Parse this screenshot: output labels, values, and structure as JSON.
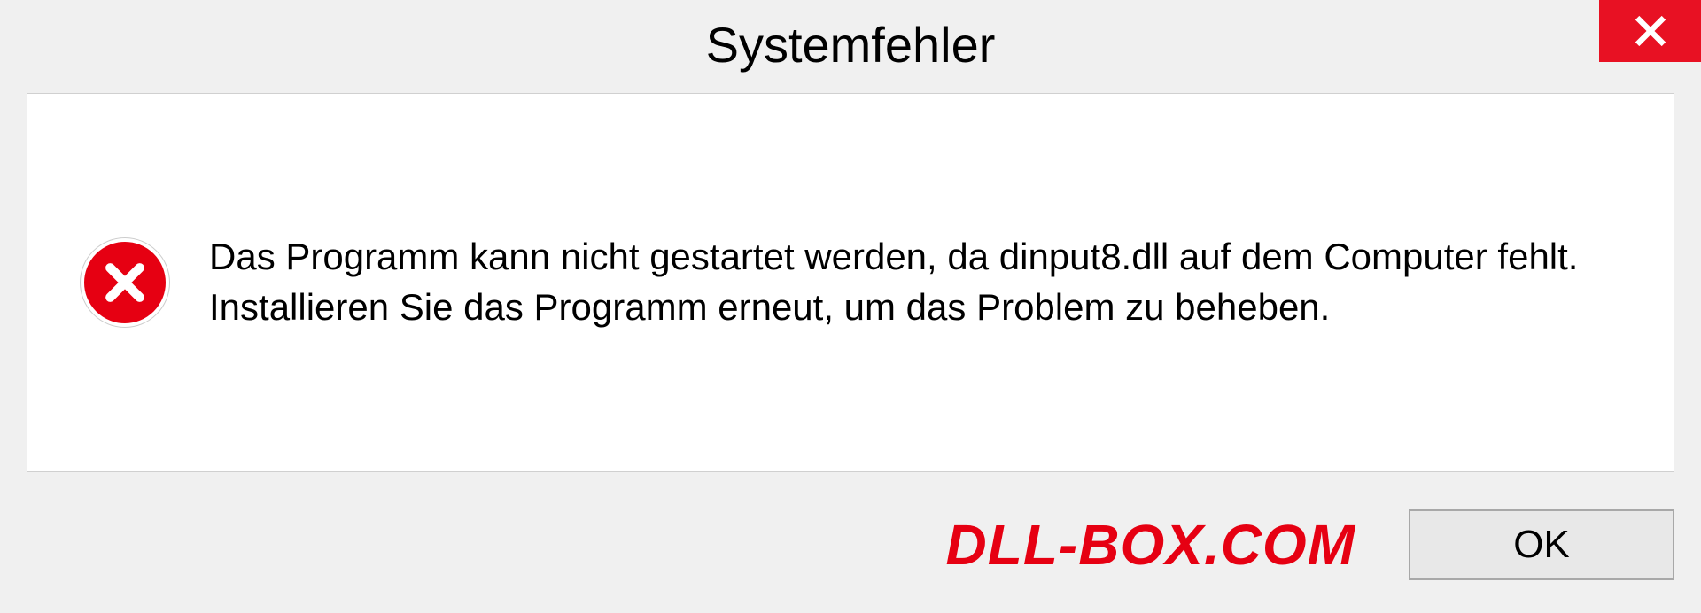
{
  "dialog": {
    "title": "Systemfehler",
    "message": "Das Programm kann nicht gestartet werden, da dinput8.dll auf dem Computer fehlt. Installieren Sie das Programm erneut, um das Problem zu beheben.",
    "ok_label": "OK",
    "watermark": "DLL-BOX.COM"
  }
}
